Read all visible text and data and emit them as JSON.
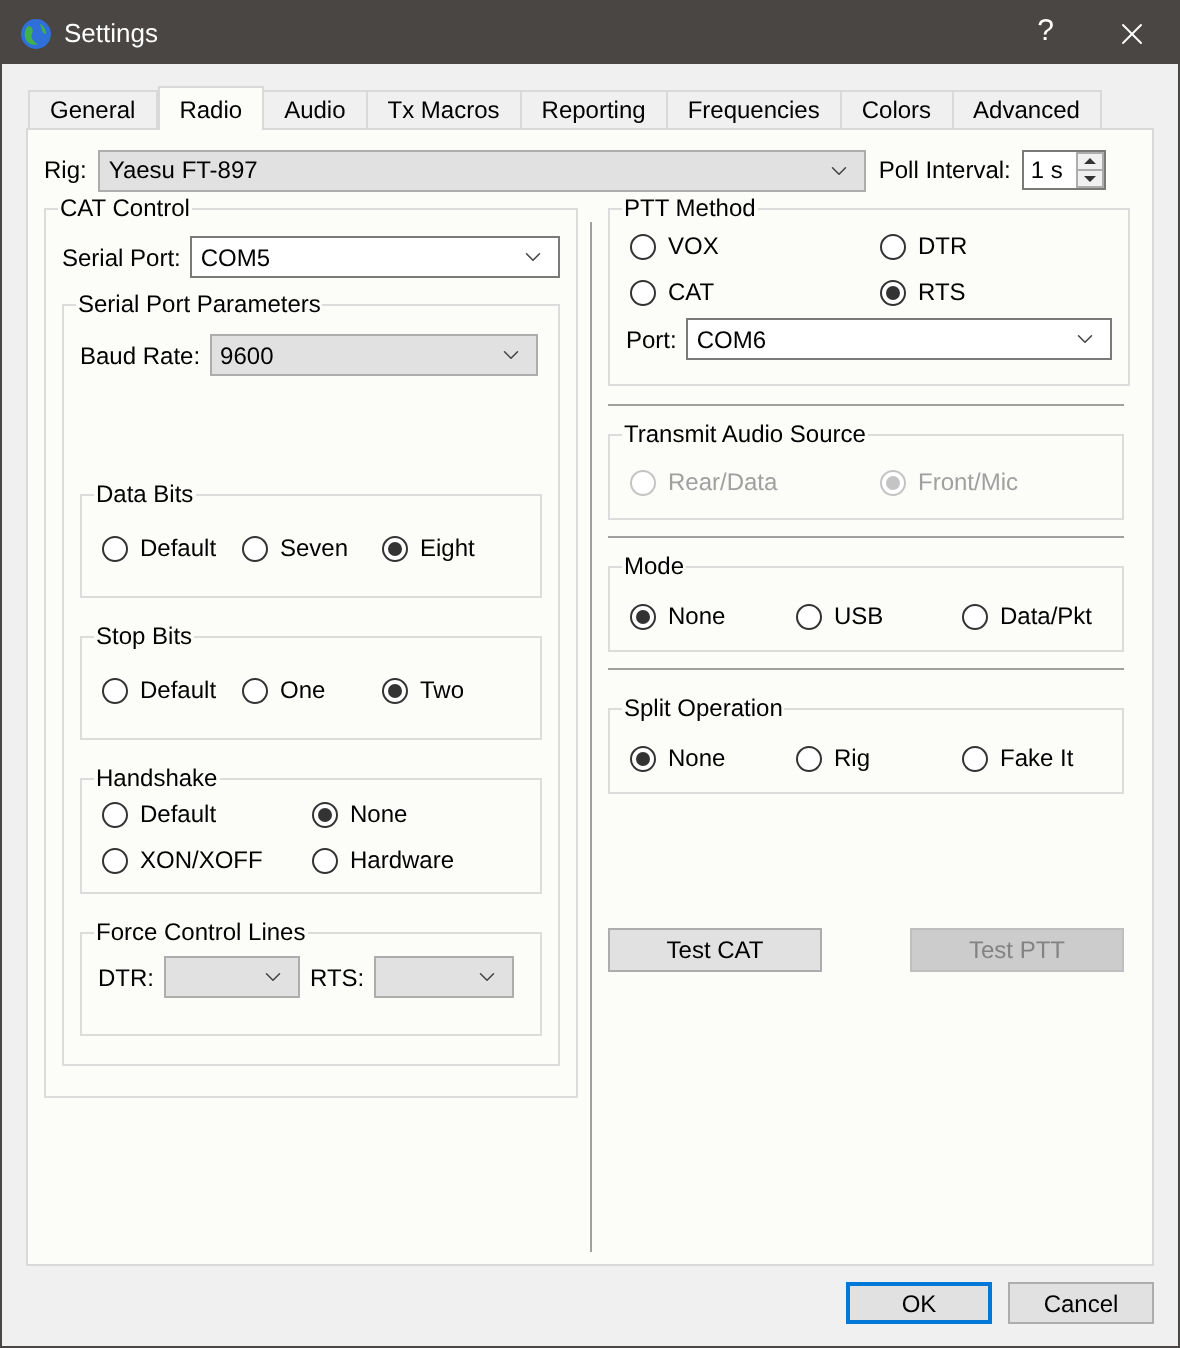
{
  "window": {
    "title": "Settings",
    "help": "?"
  },
  "tabs": [
    {
      "label": "General",
      "selected": false
    },
    {
      "label": "Radio",
      "selected": true
    },
    {
      "label": "Audio",
      "selected": false
    },
    {
      "label": "Tx Macros",
      "selected": false
    },
    {
      "label": "Reporting",
      "selected": false
    },
    {
      "label": "Frequencies",
      "selected": false
    },
    {
      "label": "Colors",
      "selected": false
    },
    {
      "label": "Advanced",
      "selected": false
    }
  ],
  "rig": {
    "label": "Rig:",
    "value": "Yaesu FT-897"
  },
  "poll_interval": {
    "label": "Poll Interval:",
    "value": "1 s"
  },
  "cat_control": {
    "title": "CAT Control",
    "serial_port": {
      "label": "Serial Port:",
      "value": "COM5"
    },
    "parameters": {
      "title": "Serial Port Parameters",
      "baud_rate": {
        "label": "Baud Rate:",
        "value": "9600"
      },
      "data_bits": {
        "title": "Data Bits",
        "options": [
          {
            "label": "Default",
            "selected": false
          },
          {
            "label": "Seven",
            "selected": false
          },
          {
            "label": "Eight",
            "selected": true
          }
        ]
      },
      "stop_bits": {
        "title": "Stop Bits",
        "options": [
          {
            "label": "Default",
            "selected": false
          },
          {
            "label": "One",
            "selected": false
          },
          {
            "label": "Two",
            "selected": true
          }
        ]
      },
      "handshake": {
        "title": "Handshake",
        "options": [
          {
            "label": "Default",
            "selected": false
          },
          {
            "label": "None",
            "selected": true
          },
          {
            "label": "XON/XOFF",
            "selected": false
          },
          {
            "label": "Hardware",
            "selected": false
          }
        ]
      },
      "force_control_lines": {
        "title": "Force Control Lines",
        "dtr": {
          "label": "DTR:"
        },
        "rts": {
          "label": "RTS:"
        }
      }
    }
  },
  "ptt_method": {
    "title": "PTT Method",
    "options": [
      {
        "label": "VOX",
        "selected": false
      },
      {
        "label": "DTR",
        "selected": false
      },
      {
        "label": "CAT",
        "selected": false
      },
      {
        "label": "RTS",
        "selected": true
      }
    ],
    "port": {
      "label": "Port:",
      "value": "COM6"
    }
  },
  "transmit_audio_source": {
    "title": "Transmit Audio Source",
    "disabled": true,
    "options": [
      {
        "label": "Rear/Data",
        "selected": false
      },
      {
        "label": "Front/Mic",
        "selected": true
      }
    ]
  },
  "mode": {
    "title": "Mode",
    "options": [
      {
        "label": "None",
        "selected": true
      },
      {
        "label": "USB",
        "selected": false
      },
      {
        "label": "Data/Pkt",
        "selected": false
      }
    ]
  },
  "split_operation": {
    "title": "Split Operation",
    "options": [
      {
        "label": "None",
        "selected": true
      },
      {
        "label": "Rig",
        "selected": false
      },
      {
        "label": "Fake It",
        "selected": false
      }
    ]
  },
  "test_buttons": [
    {
      "label": "Test CAT",
      "disabled": false
    },
    {
      "label": "Test PTT",
      "disabled": true
    }
  ],
  "dialog_buttons": [
    {
      "label": "OK",
      "default": true
    },
    {
      "label": "Cancel",
      "default": false
    }
  ]
}
